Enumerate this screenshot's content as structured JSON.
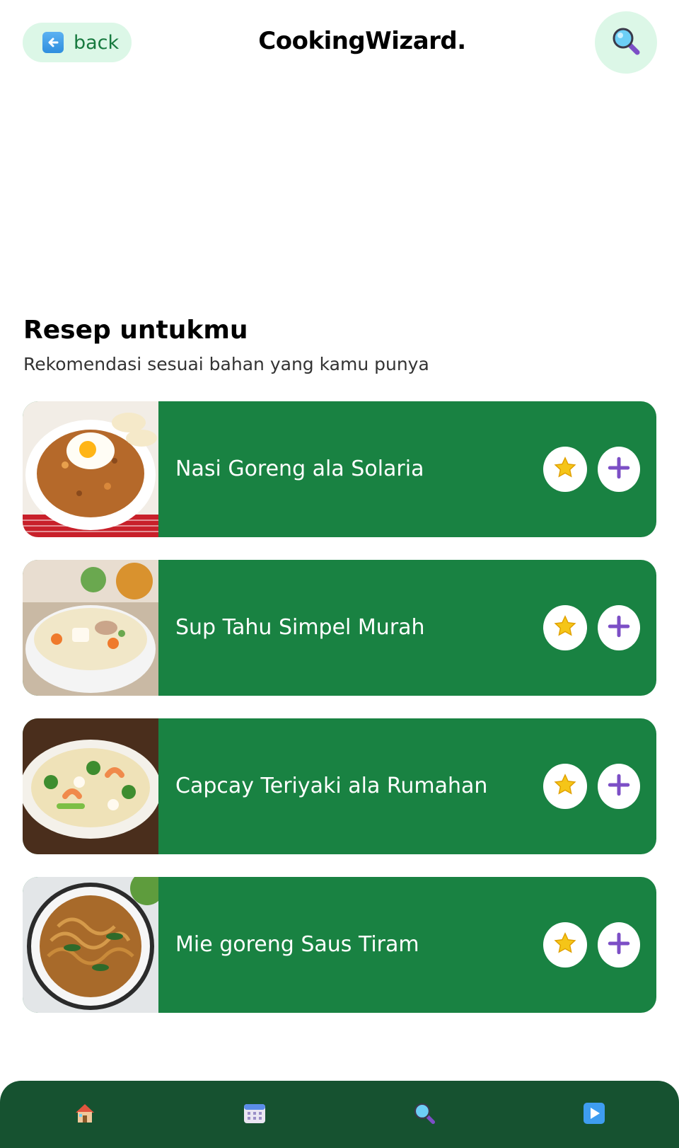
{
  "header": {
    "back_label": "back",
    "title": "CookingWizard.",
    "back_icon": "left-arrow-icon",
    "search_icon": "magnifier-icon"
  },
  "section": {
    "title": "Resep untukmu",
    "subtitle": "Rekomendasi sesuai bahan yang kamu punya"
  },
  "recipes": [
    {
      "name": "Nasi Goreng ala Solaria",
      "image": "fried-rice-photo"
    },
    {
      "name": "Sup Tahu Simpel Murah",
      "image": "tofu-soup-photo"
    },
    {
      "name": "Capcay Teriyaki ala Rumahan",
      "image": "capcay-photo"
    },
    {
      "name": "Mie goreng Saus Tiram",
      "image": "fried-noodle-photo"
    }
  ],
  "bottom_nav": {
    "items": [
      "home-icon",
      "calendar-icon",
      "search-icon",
      "play-icon"
    ]
  },
  "colors": {
    "card_green": "#198242",
    "nav_green": "#165230",
    "mint": "#dcf7e7",
    "accent_purple": "#7c4fc6",
    "star_yellow": "#f5c518"
  }
}
